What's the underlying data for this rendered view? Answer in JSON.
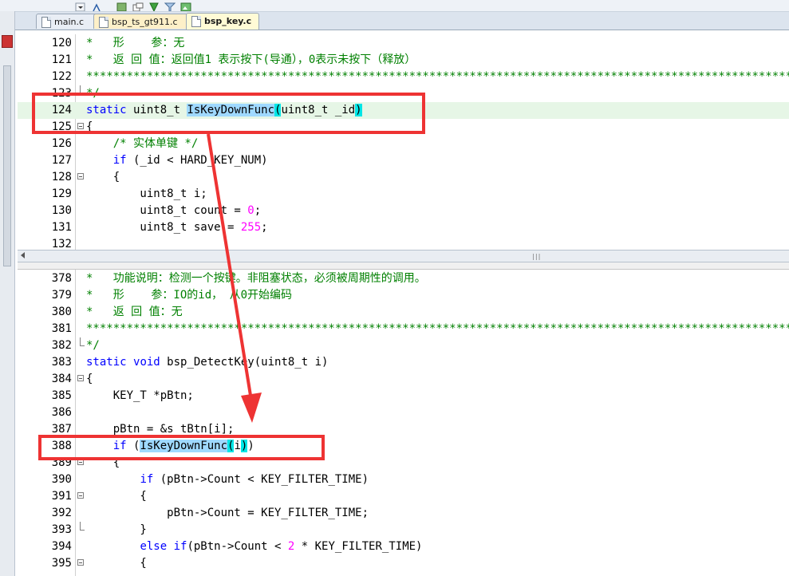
{
  "tabs": [
    {
      "label": "main.c",
      "active": false
    },
    {
      "label": "bsp_ts_gt911.c",
      "active": false
    },
    {
      "label": "bsp_key.c",
      "active": true
    }
  ],
  "top_pane": {
    "lines": [
      {
        "n": "120",
        "html": "<span class='cm'>*   形    参：无</span>"
      },
      {
        "n": "121",
        "html": "<span class='cm'>*   返 回 值：返回值1 表示按下(导通），0表示未按下（释放）</span>"
      },
      {
        "n": "122",
        "html": "<span class='cm'>*********************************************************************************************************</span>"
      },
      {
        "n": "123",
        "html": "<span class='cm'>*/</span>",
        "foldend": true
      },
      {
        "n": "124",
        "html": "<span class='kw'>static</span> uint8_t <span class='sel'>IsKeyDownFunc</span><span class='br'>(</span>uint8_t _id<span class='br'>)</span>",
        "hl": true
      },
      {
        "n": "125",
        "html": "{",
        "fold": true
      },
      {
        "n": "126",
        "html": "    <span class='cm'>/* 实体单键 */</span>"
      },
      {
        "n": "127",
        "html": "    <span class='kw'>if</span> (_id &lt; HARD_KEY_NUM)"
      },
      {
        "n": "128",
        "html": "    {",
        "fold": true
      },
      {
        "n": "129",
        "html": "        uint8_t i;"
      },
      {
        "n": "130",
        "html": "        uint8_t count = <span class='num'>0</span>;"
      },
      {
        "n": "131",
        "html": "        uint8_t save = <span class='num'>255</span>;"
      },
      {
        "n": "132",
        "html": ""
      }
    ]
  },
  "bottom_pane": {
    "lines": [
      {
        "n": "378",
        "html": "<span class='cm'>*   功能说明：检测一个按键。非阻塞状态，必须被周期性的调用。</span>"
      },
      {
        "n": "379",
        "html": "<span class='cm'>*   形    参：IO的id， 从0开始编码</span>"
      },
      {
        "n": "380",
        "html": "<span class='cm'>*   返 回 值：无</span>"
      },
      {
        "n": "381",
        "html": "<span class='cm'>*********************************************************************************************************</span>"
      },
      {
        "n": "382",
        "html": "<span class='cm'>*/</span>",
        "foldend": true
      },
      {
        "n": "383",
        "html": "<span class='kw'>static</span> <span class='kw'>void</span> bsp_DetectKey(uint8_t i)"
      },
      {
        "n": "384",
        "html": "{",
        "fold": true
      },
      {
        "n": "385",
        "html": "    KEY_T *pBtn;"
      },
      {
        "n": "386",
        "html": ""
      },
      {
        "n": "387",
        "html": "    pBtn = &amp;s_tBtn[i];"
      },
      {
        "n": "388",
        "html": "    <span class='kw'>if</span> (<span class='sel'>IsKeyDownFunc</span><span class='br'>(</span>i<span class='br'>)</span>)"
      },
      {
        "n": "389",
        "html": "    {",
        "fold": true
      },
      {
        "n": "390",
        "html": "        <span class='kw'>if</span> (pBtn-&gt;Count &lt; KEY_FILTER_TIME)"
      },
      {
        "n": "391",
        "html": "        {",
        "fold": true
      },
      {
        "n": "392",
        "html": "            pBtn-&gt;Count = KEY_FILTER_TIME;"
      },
      {
        "n": "393",
        "html": "        }",
        "foldend": true
      },
      {
        "n": "394",
        "html": "        <span class='kw'>else</span> <span class='kw'>if</span>(pBtn-&gt;Count &lt; <span class='num'>2</span> * KEY_FILTER_TIME)"
      },
      {
        "n": "395",
        "html": "        {",
        "fold": true
      }
    ]
  },
  "colors": {
    "annotation": "#ee3333",
    "keyword": "#0000ff",
    "comment": "#008000",
    "number": "#ff00ff",
    "selection": "#9fd9ff"
  }
}
